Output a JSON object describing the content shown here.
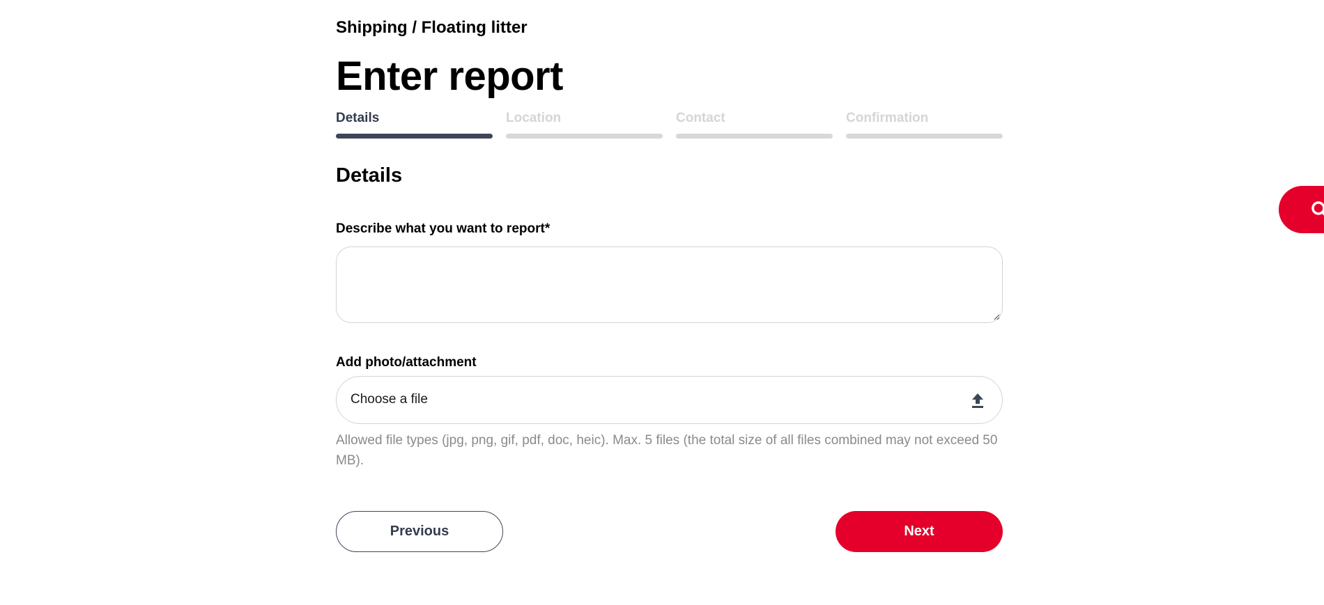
{
  "breadcrumb": "Shipping / Floating litter",
  "page_title": "Enter report",
  "steps": [
    {
      "label": "Details",
      "active": true
    },
    {
      "label": "Location",
      "active": false
    },
    {
      "label": "Contact",
      "active": false
    },
    {
      "label": "Confirmation",
      "active": false
    }
  ],
  "section_title": "Details",
  "describe": {
    "label": "Describe what you want to report*",
    "value": ""
  },
  "attachment": {
    "label": "Add photo/attachment",
    "placeholder": "Choose a file",
    "icon": "upload-icon",
    "hint": "Allowed file types (jpg, png, gif, pdf, doc, heic). Max. 5 files (the total size of all files combined may not exceed 50 MB)."
  },
  "buttons": {
    "previous": "Previous",
    "next": "Next"
  },
  "floating_search": {
    "icon": "search-icon"
  },
  "colors": {
    "accent": "#e4002b",
    "step_active": "#3d4659",
    "step_inactive": "#d8d8d8",
    "hint_text": "#8a8a8a"
  }
}
